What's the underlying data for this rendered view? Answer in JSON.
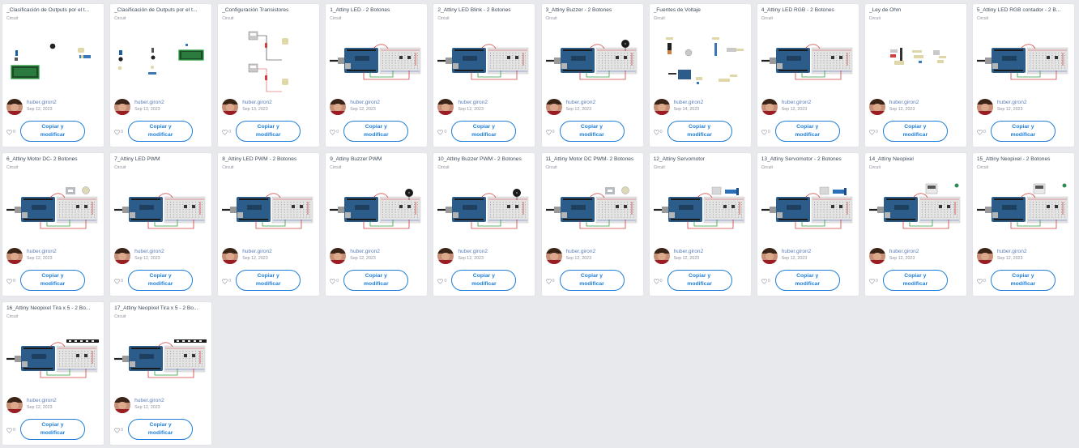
{
  "colors": {
    "accent": "#1e7ed8",
    "user_link": "#5a7fb8",
    "background": "#e8e9ec",
    "arduino": "#2b5c8a",
    "breadboard": "#e4e4e4"
  },
  "like_icon": "heart-outline-icon",
  "cards": [
    {
      "title": "_Clasificación de Outputs por el t...",
      "type": "Circuit",
      "user": "huber.giron2",
      "date": "Sep 12, 2023",
      "likes": "0",
      "button_line1": "Copiar y",
      "button_line2": "modificar",
      "thumb": "lcd"
    },
    {
      "title": "_Clasificación de Outputs por el t...",
      "type": "Circuit",
      "user": "huber.giron2",
      "date": "Sep 13, 2023",
      "likes": "0",
      "button_line1": "Copiar y",
      "button_line2": "modificar",
      "thumb": "lcd2"
    },
    {
      "title": "_Configuración Transistores",
      "type": "Circuit",
      "user": "huber.giron2",
      "date": "Sep 13, 2023",
      "likes": "0",
      "button_line1": "Copiar y",
      "button_line2": "modificar",
      "thumb": "transistor"
    },
    {
      "title": "1_Attiny LED - 2 Botones",
      "type": "Circuit",
      "user": "huber.giron2",
      "date": "Sep 12, 2023",
      "likes": "0",
      "button_line1": "Copiar y",
      "button_line2": "modificar",
      "thumb": "arduino"
    },
    {
      "title": "2_Attiny LED Blink - 2 Botones",
      "type": "Circuit",
      "user": "huber.giron2",
      "date": "Sep 12, 2023",
      "likes": "0",
      "button_line1": "Copiar y",
      "button_line2": "modificar",
      "thumb": "arduino"
    },
    {
      "title": "3_Attiny Buzzer - 2 Botones",
      "type": "Circuit",
      "user": "huber.giron2",
      "date": "Sep 12, 2023",
      "likes": "0",
      "button_line1": "Copiar y",
      "button_line2": "modificar",
      "thumb": "buzzer"
    },
    {
      "title": "_Fuentes de Voltaje",
      "type": "Circuit",
      "user": "huber.giron2",
      "date": "Sep 14, 2023",
      "likes": "0",
      "button_line1": "Copiar y",
      "button_line2": "modificar",
      "thumb": "sources"
    },
    {
      "title": "4_Attiny LED RGB - 2 Botones",
      "type": "Circuit",
      "user": "huber.giron2",
      "date": "Sep 12, 2023",
      "likes": "0",
      "button_line1": "Copiar y",
      "button_line2": "modificar",
      "thumb": "arduino"
    },
    {
      "title": "_Ley de Ohm",
      "type": "Circuit",
      "user": "huber.giron2",
      "date": "Sep 12, 2023",
      "likes": "0",
      "button_line1": "Copiar y",
      "button_line2": "modificar",
      "thumb": "ohm"
    },
    {
      "title": "5_Attiny LED RGB contador - 2 B...",
      "type": "Circuit",
      "user": "huber.giron2",
      "date": "Sep 12, 2023",
      "likes": "0",
      "button_line1": "Copiar y",
      "button_line2": "modificar",
      "thumb": "arduino"
    },
    {
      "title": "6_Attiny Motor DC- 2 Botones",
      "type": "Circuit",
      "user": "huber.giron2",
      "date": "Sep 12, 2023",
      "likes": "0",
      "button_line1": "Copiar y",
      "button_line2": "modificar",
      "thumb": "motor"
    },
    {
      "title": "7_Attiny LED PWM",
      "type": "Circuit",
      "user": "huber.giron2",
      "date": "Sep 12, 2023",
      "likes": "0",
      "button_line1": "Copiar y",
      "button_line2": "modificar",
      "thumb": "arduino"
    },
    {
      "title": "8_Attiny LED PWM - 2 Botones",
      "type": "Circuit",
      "user": "huber.giron2",
      "date": "Sep 12, 2023",
      "likes": "0",
      "button_line1": "Copiar y",
      "button_line2": "modificar",
      "thumb": "arduino"
    },
    {
      "title": "9_Attiny Buzzer PWM",
      "type": "Circuit",
      "user": "huber.giron2",
      "date": "Sep 12, 2023",
      "likes": "0",
      "button_line1": "Copiar y",
      "button_line2": "modificar",
      "thumb": "buzzer"
    },
    {
      "title": "10_Attiny Buzzer PWM - 2 Botones",
      "type": "Circuit",
      "user": "huber.giron2",
      "date": "Sep 12, 2023",
      "likes": "0",
      "button_line1": "Copiar y",
      "button_line2": "modificar",
      "thumb": "buzzer"
    },
    {
      "title": "11_Attiny Motor DC PWM- 2 Botones",
      "type": "Circuit",
      "user": "huber.giron2",
      "date": "Sep 12, 2023",
      "likes": "0",
      "button_line1": "Copiar y",
      "button_line2": "modificar",
      "thumb": "motor"
    },
    {
      "title": "12_Attiny Servomotor",
      "type": "Circuit",
      "user": "huber.giron2",
      "date": "Sep 12, 2023",
      "likes": "0",
      "button_line1": "Copiar y",
      "button_line2": "modificar",
      "thumb": "servo"
    },
    {
      "title": "13_Attiny Servomotor - 2 Botones",
      "type": "Circuit",
      "user": "huber.giron2",
      "date": "Sep 12, 2023",
      "likes": "0",
      "button_line1": "Copiar y",
      "button_line2": "modificar",
      "thumb": "servo"
    },
    {
      "title": "14_Attiny Neopixel",
      "type": "Circuit",
      "user": "huber.giron2",
      "date": "Sep 12, 2023",
      "likes": "0",
      "button_line1": "Copiar y",
      "button_line2": "modificar",
      "thumb": "neopixel"
    },
    {
      "title": "15_Attiny Neopixel - 2 Botones",
      "type": "Circuit",
      "user": "huber.giron2",
      "date": "Sep 12, 2023",
      "likes": "0",
      "button_line1": "Copiar y",
      "button_line2": "modificar",
      "thumb": "neopixel"
    },
    {
      "title": "16_Attiny Neopixel Tira x 5 - 2 Bo...",
      "type": "Circuit",
      "user": "huber.giron2",
      "date": "Sep 12, 2023",
      "likes": "0",
      "button_line1": "Copiar y",
      "button_line2": "modificar",
      "thumb": "strip"
    },
    {
      "title": "17_Attiny Neopixel Tira x 5 - 2 Bo...",
      "type": "Circuit",
      "user": "huber.giron2",
      "date": "Sep 12, 2023",
      "likes": "0",
      "button_line1": "Copiar y",
      "button_line2": "modificar",
      "thumb": "strip"
    }
  ]
}
